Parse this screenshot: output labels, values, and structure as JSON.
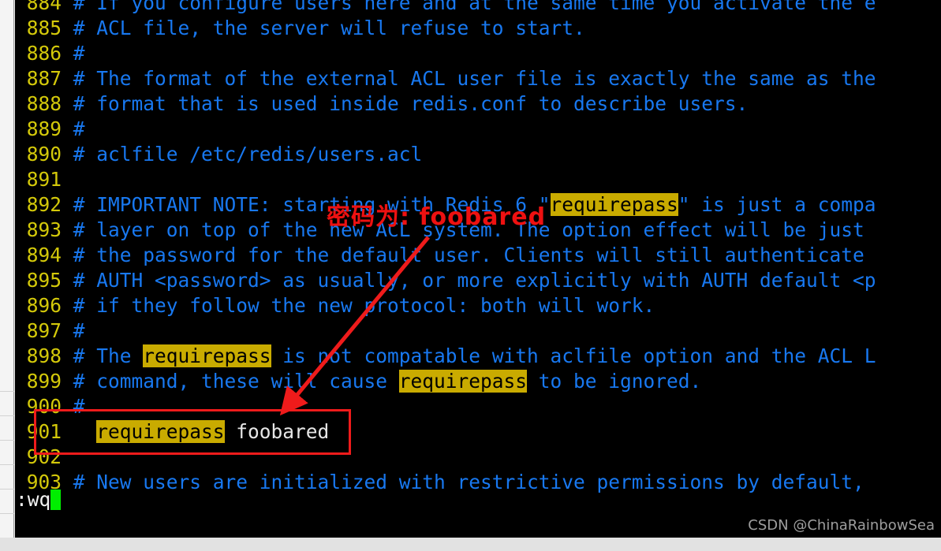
{
  "app": {
    "editor": "vim",
    "file": "redis.conf",
    "background": "#000000",
    "comment_color": "#1878f0",
    "linenumber_color": "#d4c90a",
    "search_highlight_color": "#c9ab00",
    "annotation_color": "#ee1111",
    "cursor_color": "#00ee00",
    "text_color": "#e6e6e6"
  },
  "buffer": {
    "lines": [
      {
        "num": "884",
        "clipped_top": true,
        "segments": [
          {
            "kind": "comment",
            "text": "# If you configure users here and at the same time you activate the e"
          }
        ]
      },
      {
        "num": "885",
        "segments": [
          {
            "kind": "comment",
            "text": "# ACL file, the server will refuse to start."
          }
        ]
      },
      {
        "num": "886",
        "segments": [
          {
            "kind": "comment",
            "text": "#"
          }
        ]
      },
      {
        "num": "887",
        "segments": [
          {
            "kind": "comment",
            "text": "# The format of the external ACL user file is exactly the same as the"
          }
        ]
      },
      {
        "num": "888",
        "segments": [
          {
            "kind": "comment",
            "text": "# format that is used inside redis.conf to describe users."
          }
        ]
      },
      {
        "num": "889",
        "segments": [
          {
            "kind": "comment",
            "text": "#"
          }
        ]
      },
      {
        "num": "890",
        "segments": [
          {
            "kind": "comment",
            "text": "# aclfile /etc/redis/users.acl"
          }
        ]
      },
      {
        "num": "891",
        "segments": []
      },
      {
        "num": "892",
        "segments": [
          {
            "kind": "comment",
            "text": "# IMPORTANT NOTE: starting with Redis 6 \""
          },
          {
            "kind": "highlight",
            "text": "requirepass"
          },
          {
            "kind": "comment",
            "text": "\" is just a compa"
          }
        ]
      },
      {
        "num": "893",
        "segments": [
          {
            "kind": "comment",
            "text": "# layer on top of the new ACL system. The option effect will be just"
          }
        ]
      },
      {
        "num": "894",
        "segments": [
          {
            "kind": "comment",
            "text": "# the password for the default user. Clients will still authenticate"
          }
        ]
      },
      {
        "num": "895",
        "segments": [
          {
            "kind": "comment",
            "text": "# AUTH <password> as usually, or more explicitly with AUTH default <p"
          }
        ]
      },
      {
        "num": "896",
        "segments": [
          {
            "kind": "comment",
            "text": "# if they follow the new protocol: both will work."
          }
        ]
      },
      {
        "num": "897",
        "segments": [
          {
            "kind": "comment",
            "text": "#"
          }
        ]
      },
      {
        "num": "898",
        "segments": [
          {
            "kind": "comment",
            "text": "# The "
          },
          {
            "kind": "highlight",
            "text": "requirepass"
          },
          {
            "kind": "comment",
            "text": " is not compatable with aclfile option and the ACL L"
          }
        ]
      },
      {
        "num": "899",
        "segments": [
          {
            "kind": "comment",
            "text": "# command, these will cause "
          },
          {
            "kind": "highlight",
            "text": "requirepass"
          },
          {
            "kind": "comment",
            "text": " to be ignored."
          }
        ]
      },
      {
        "num": "900",
        "segments": [
          {
            "kind": "comment",
            "text": "#"
          }
        ]
      },
      {
        "num": "901",
        "segments": [
          {
            "kind": "plain",
            "text": "  "
          },
          {
            "kind": "highlight",
            "text": "requirepass"
          },
          {
            "kind": "plain",
            "text": " foobared"
          }
        ]
      },
      {
        "num": "902",
        "segments": []
      },
      {
        "num": "903",
        "segments": [
          {
            "kind": "comment",
            "text": "# New users are initialized with restrictive permissions by default,"
          }
        ]
      }
    ]
  },
  "command_line": {
    "text": ":wq",
    "cursor": "block-cursor"
  },
  "annotations": {
    "note_text": "密码为: foobared",
    "arrow": "red-arrow-from-note-to-line-901",
    "box": "red-rectangle-around-line-901"
  },
  "watermark": {
    "text": "CSDN @ChinaRainbowSea"
  }
}
